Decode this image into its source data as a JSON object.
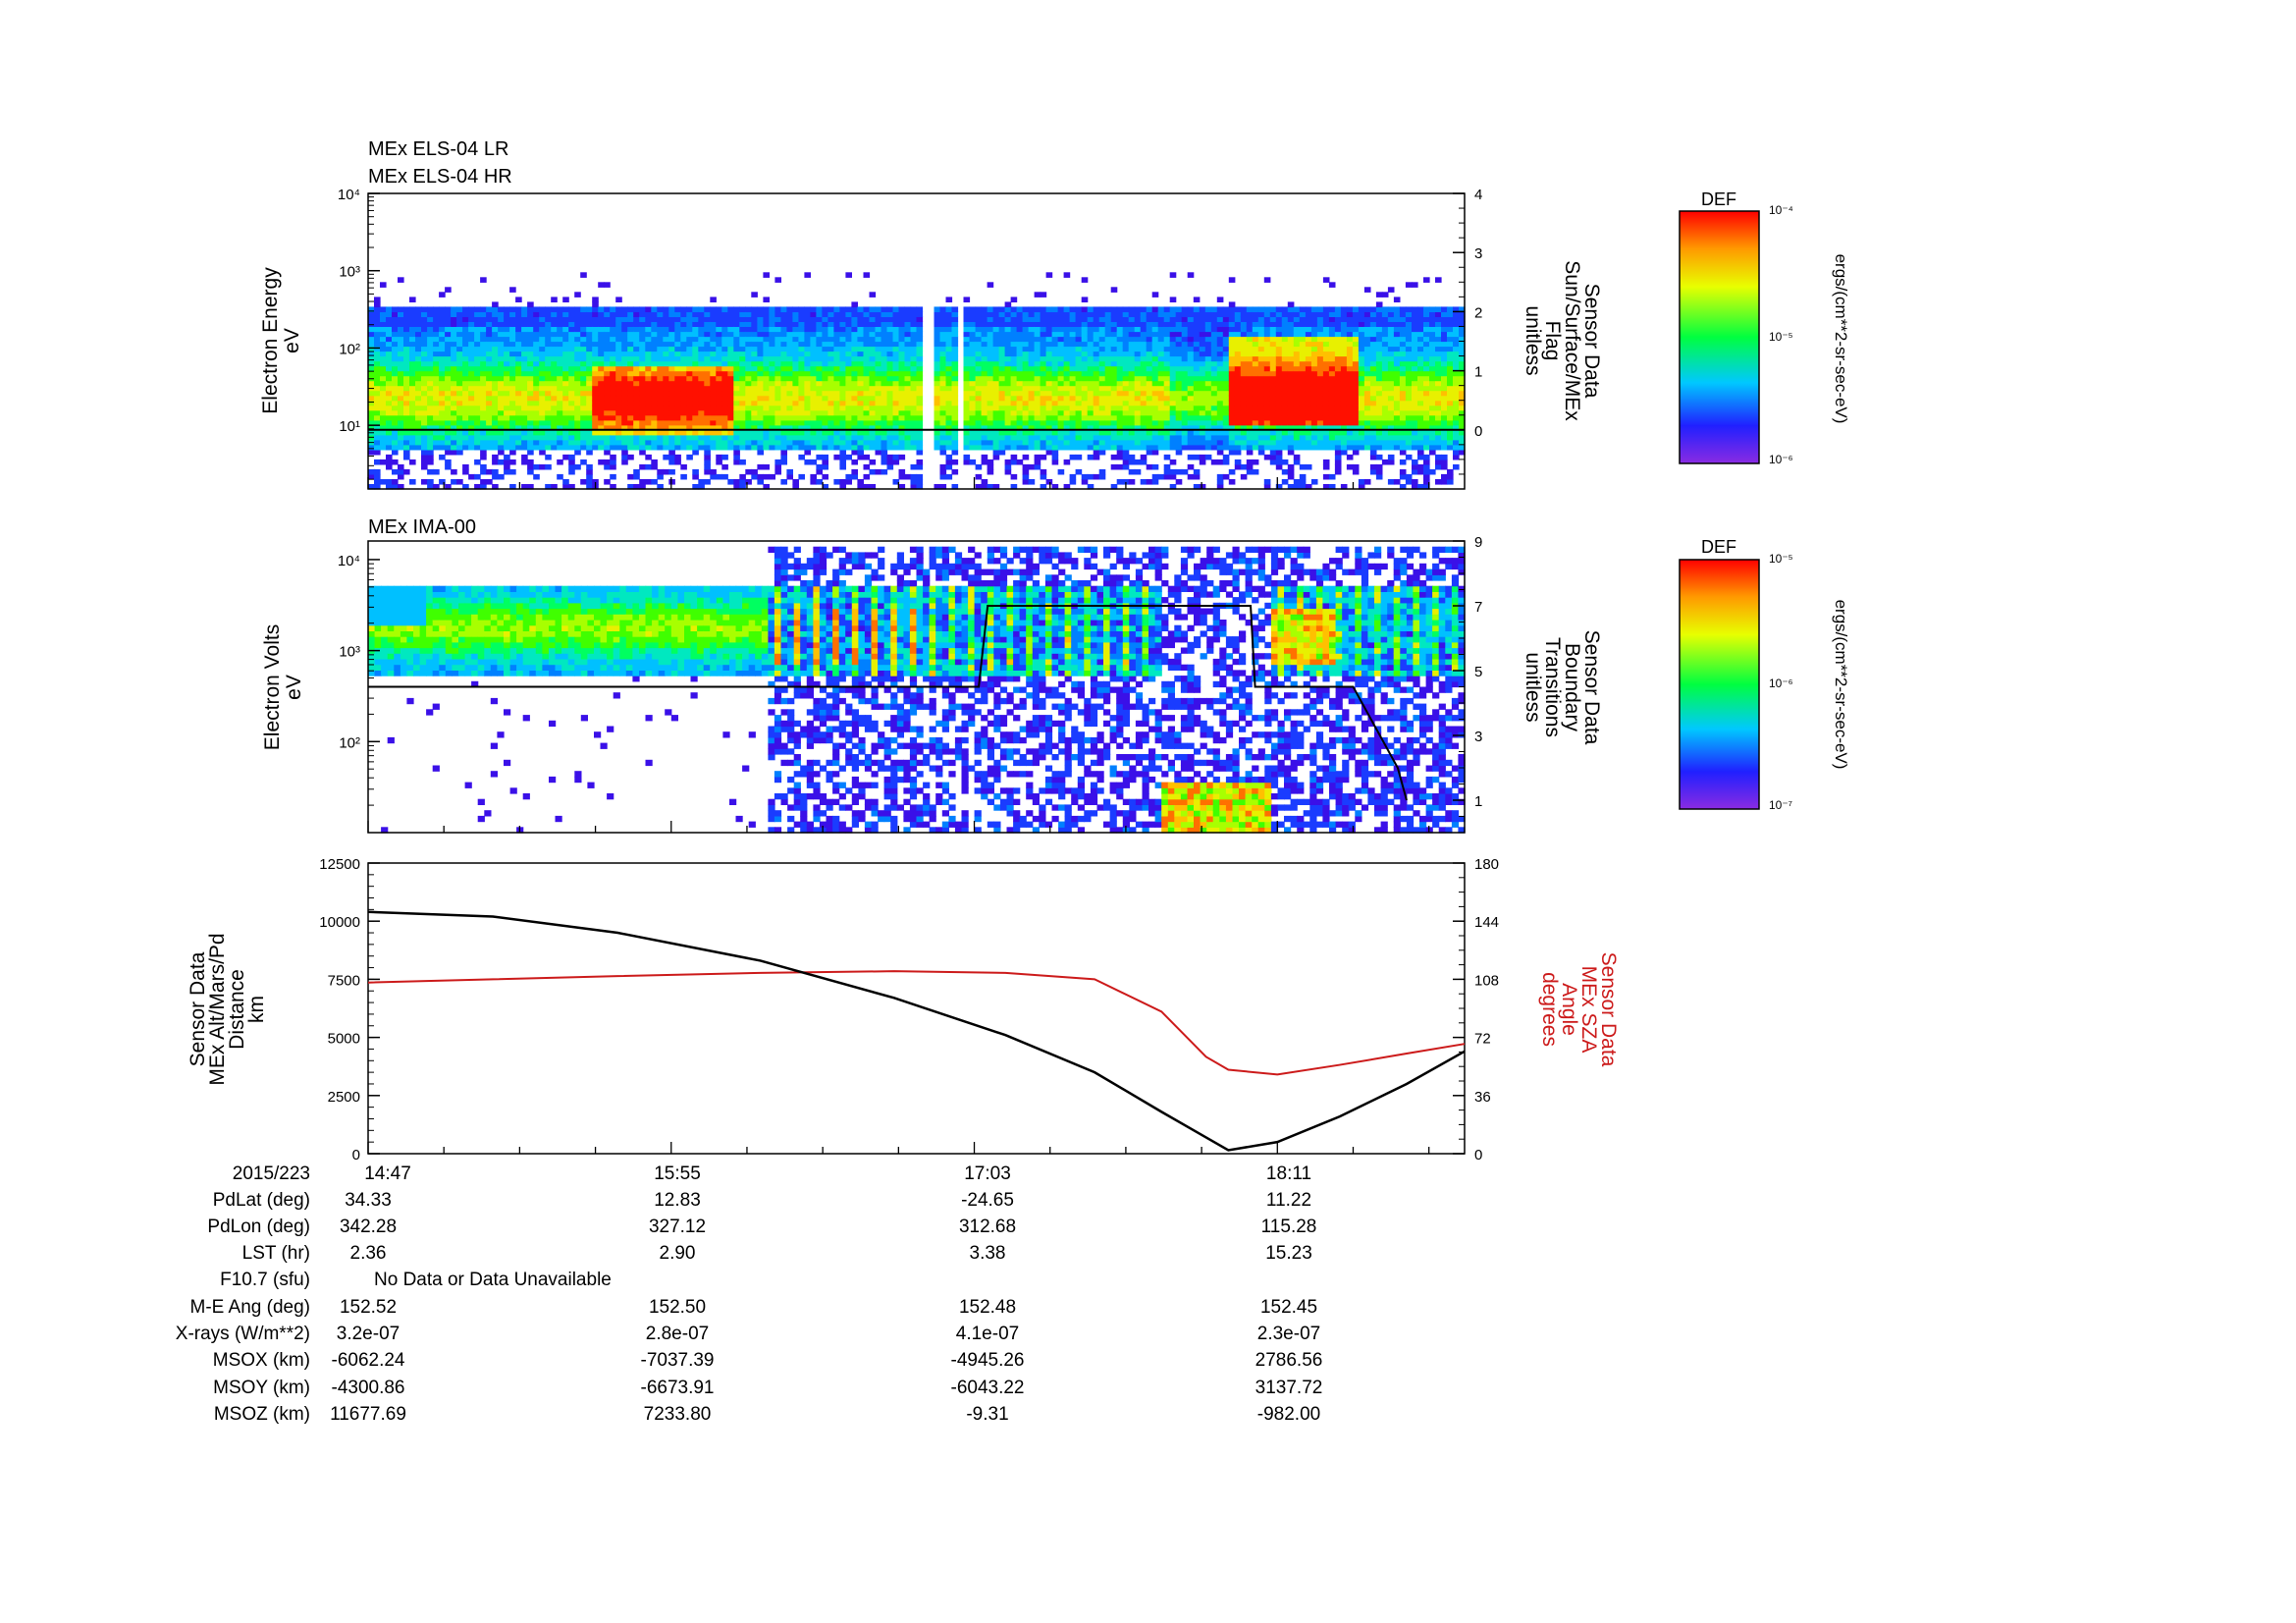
{
  "panels": {
    "els": {
      "title1": "MEx ELS-04 LR",
      "title2": "MEx ELS-04 HR",
      "ylabel": [
        "Electron Energy",
        "eV"
      ],
      "y_ticks": [
        "10⁴",
        "10³",
        "10²",
        "10¹"
      ],
      "right_ylabel": [
        "Sensor Data",
        "Sun/Surface/MEx",
        "Flag",
        "unitless"
      ],
      "right_ticks": [
        "4",
        "3",
        "2",
        "1",
        "0"
      ],
      "colorbar_title": "DEF",
      "colorbar_top": "10⁻⁴",
      "colorbar_mid": "10⁻⁵",
      "colorbar_bottom": "10⁻⁶",
      "colorbar_units": "ergs/(cm**2-sr-sec-eV)"
    },
    "ima": {
      "title": "MEx IMA-00",
      "ylabel": [
        "Electron Volts",
        "eV"
      ],
      "y_ticks": [
        "10⁴",
        "10³",
        "10²"
      ],
      "right_ylabel": [
        "Sensor Data",
        "Boundary",
        "Transitions",
        "unitless"
      ],
      "right_ticks": [
        "9",
        "7",
        "5",
        "3",
        "1"
      ],
      "colorbar_title": "DEF",
      "colorbar_top": "10⁻⁵",
      "colorbar_mid": "10⁻⁶",
      "colorbar_bottom": "10⁻⁷",
      "colorbar_units": "ergs/(cm**2-sr-sec-eV)"
    },
    "line": {
      "ylabel": [
        "Sensor Data",
        "MEx Alt/Mars/Pd",
        "Distance",
        "km"
      ],
      "y_ticks": [
        "12500",
        "10000",
        "7500",
        "5000",
        "2500",
        "0"
      ],
      "right_ylabel": [
        "Sensor Data",
        "MEx SZA",
        "Angle",
        "degrees"
      ],
      "right_ticks": [
        "180",
        "144",
        "108",
        "72",
        "36",
        "0"
      ]
    }
  },
  "colors": {
    "sza_line": "#cc1a1a",
    "alt_line": "#000000"
  },
  "chart_data": [
    {
      "type": "heatmap",
      "name": "MEx ELS-04",
      "x_range": [
        "14:47",
        "18:53"
      ],
      "y_scale": "log",
      "ylim": [
        1.5,
        10000
      ],
      "flag_series": {
        "x": [
          "14:47",
          "18:53"
        ],
        "values": [
          0,
          0
        ]
      },
      "right_ylim": [
        -1,
        4
      ]
    },
    {
      "type": "heatmap",
      "name": "MEx IMA-00",
      "x_range": [
        "14:47",
        "18:53"
      ],
      "y_scale": "log",
      "ylim": [
        10,
        16000
      ],
      "boundary_series": {
        "x": [
          "14:47",
          "17:04",
          "17:06",
          "18:05",
          "18:06",
          "18:28",
          "18:38",
          "18:40"
        ],
        "values": [
          4.5,
          4.5,
          7,
          7,
          4.5,
          4.5,
          2,
          1
        ]
      },
      "right_ylim": [
        0,
        9
      ]
    },
    {
      "type": "line",
      "x": [
        "14:47",
        "15:15",
        "15:43",
        "16:15",
        "16:45",
        "17:10",
        "17:30",
        "17:45",
        "17:55",
        "18:00",
        "18:11",
        "18:25",
        "18:40",
        "18:53"
      ],
      "series": [
        {
          "axis": "left",
          "values": [
            10400,
            10200,
            9500,
            8300,
            6700,
            5100,
            3500,
            1800,
            700,
            150,
            500,
            1600,
            3000,
            4400
          ]
        },
        {
          "axis": "right",
          "values": [
            106,
            108,
            110,
            112,
            113,
            112,
            108,
            88,
            60,
            52,
            49,
            55,
            62,
            68
          ]
        }
      ],
      "ylim": [
        0,
        12500
      ],
      "right_ylim": [
        0,
        180
      ]
    }
  ],
  "x_ticks": [
    "14:47",
    "15:55",
    "17:03",
    "18:11"
  ],
  "orbit_table": {
    "labels": [
      "2015/223",
      "PdLat (deg)",
      "PdLon (deg)",
      "LST (hr)",
      "F10.7 (sfu)",
      "M-E Ang (deg)",
      "X-rays (W/m**2)",
      "MSOX (km)",
      "MSOY (km)",
      "MSOZ (km)"
    ],
    "f107_note": "No Data or Data Unavailable",
    "columns": [
      [
        "14:47",
        "34.33",
        "342.28",
        "2.36",
        "",
        "152.52",
        "3.2e-07",
        "-6062.24",
        "-4300.86",
        "11677.69"
      ],
      [
        "15:55",
        "12.83",
        "327.12",
        "2.90",
        "",
        "152.50",
        "2.8e-07",
        "-7037.39",
        "-6673.91",
        "7233.80"
      ],
      [
        "17:03",
        "-24.65",
        "312.68",
        "3.38",
        "",
        "152.48",
        "4.1e-07",
        "-4945.26",
        "-6043.22",
        "-9.31"
      ],
      [
        "18:11",
        "11.22",
        "115.28",
        "15.23",
        "",
        "152.45",
        "2.3e-07",
        "2786.56",
        "3137.72",
        "-982.00"
      ]
    ]
  }
}
